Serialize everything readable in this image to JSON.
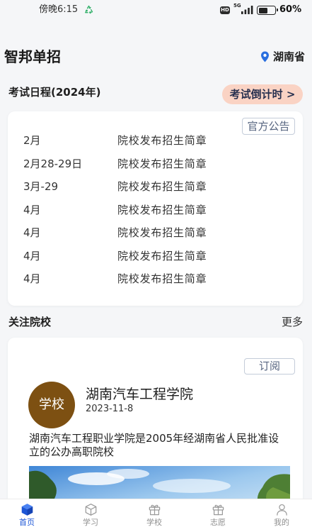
{
  "status_bar": {
    "time": "傍晚6:15",
    "hd_label": "HD",
    "network": "5G",
    "battery": "60%",
    "battery_level": 0.6
  },
  "header": {
    "title": "智邦单招",
    "location": "湖南省"
  },
  "schedule": {
    "title": "考试日程(2024年)",
    "countdown_label": "考试倒计时 >",
    "notice_label": "官方公告",
    "rows": [
      {
        "date": "2月",
        "event": "院校发布招生简章"
      },
      {
        "date": "2月28-29日",
        "event": "院校发布招生简章"
      },
      {
        "date": "3月-29",
        "event": "院校发布招生简章"
      },
      {
        "date": "4月",
        "event": "院校发布招生简章"
      },
      {
        "date": "4月",
        "event": "院校发布招生简章"
      },
      {
        "date": "4月",
        "event": "院校发布招生简章"
      },
      {
        "date": "4月",
        "event": "院校发布招生简章"
      }
    ]
  },
  "followed": {
    "title": "关注院校",
    "more_label": "更多",
    "school": {
      "subscribe_label": "订阅",
      "avatar_text": "学校",
      "name": "湖南汽车工程学院",
      "date": "2023-11-8",
      "description": "湖南汽车工程职业学院是2005年经湖南省人民批准设立的公办高职院校"
    }
  },
  "nav": {
    "items": [
      {
        "label": "首页",
        "icon": "home-cube-icon",
        "active": true
      },
      {
        "label": "学习",
        "icon": "study-box-icon",
        "active": false
      },
      {
        "label": "学校",
        "icon": "school-gift-icon",
        "active": false
      },
      {
        "label": "志愿",
        "icon": "volunteer-gift-icon",
        "active": false
      },
      {
        "label": "我的",
        "icon": "profile-person-icon",
        "active": false
      }
    ]
  },
  "icons": {
    "status_notification": "recycle-icon",
    "location": "location-pin-icon"
  },
  "colors": {
    "page_bg": "#f5f6f8",
    "accent": "#1d56d6",
    "countdown_bg": "#fad3c4",
    "avatar_bg": "#7d5012",
    "location_pin": "#2a6fdf",
    "inactive": "#8f8f8f"
  }
}
